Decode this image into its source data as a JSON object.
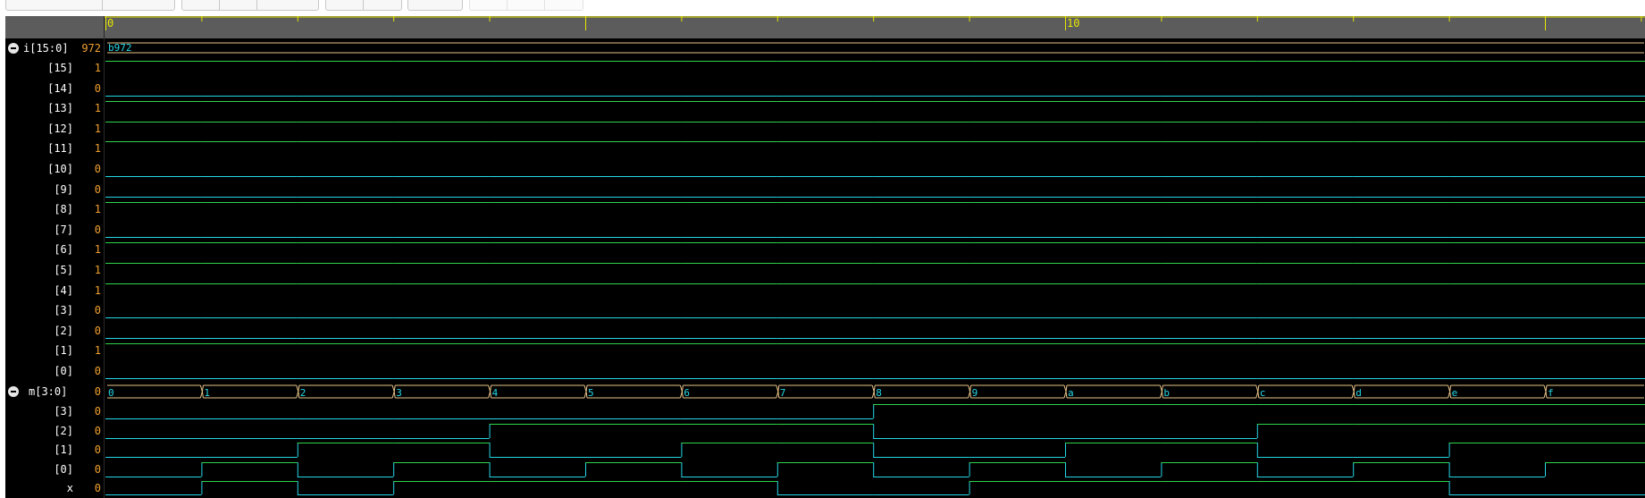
{
  "timeline": {
    "labels": [
      "0",
      "10"
    ]
  },
  "signals": {
    "i_group": {
      "name": "i[15:0]",
      "value": "972",
      "bus_value": "b972",
      "bits": [
        {
          "name": "[15]",
          "value": "1"
        },
        {
          "name": "[14]",
          "value": "0"
        },
        {
          "name": "[13]",
          "value": "1"
        },
        {
          "name": "[12]",
          "value": "1"
        },
        {
          "name": "[11]",
          "value": "1"
        },
        {
          "name": "[10]",
          "value": "0"
        },
        {
          "name": "[9]",
          "value": "0"
        },
        {
          "name": "[8]",
          "value": "1"
        },
        {
          "name": "[7]",
          "value": "0"
        },
        {
          "name": "[6]",
          "value": "1"
        },
        {
          "name": "[5]",
          "value": "1"
        },
        {
          "name": "[4]",
          "value": "1"
        },
        {
          "name": "[3]",
          "value": "0"
        },
        {
          "name": "[2]",
          "value": "0"
        },
        {
          "name": "[1]",
          "value": "1"
        },
        {
          "name": "[0]",
          "value": "0"
        }
      ]
    },
    "m_group": {
      "name": "m[3:0]",
      "value": "0",
      "bus_values": [
        "0",
        "1",
        "2",
        "3",
        "4",
        "5",
        "6",
        "7",
        "8",
        "9",
        "a",
        "b",
        "c",
        "d",
        "e",
        "f"
      ],
      "bits": [
        {
          "name": "[3]",
          "value": "0"
        },
        {
          "name": "[2]",
          "value": "0"
        },
        {
          "name": "[1]",
          "value": "0"
        },
        {
          "name": "[0]",
          "value": "0"
        }
      ]
    },
    "x": {
      "name": "x",
      "value": "0",
      "trace": [
        0,
        1,
        0,
        1,
        1,
        1,
        1,
        0,
        0,
        1,
        1,
        1,
        1,
        1,
        0,
        0
      ]
    }
  },
  "colors": {
    "high": "#2fd44a",
    "low": "#25d7e6",
    "bus": "#e8c48a",
    "timeline_tick": "#e8e800"
  }
}
